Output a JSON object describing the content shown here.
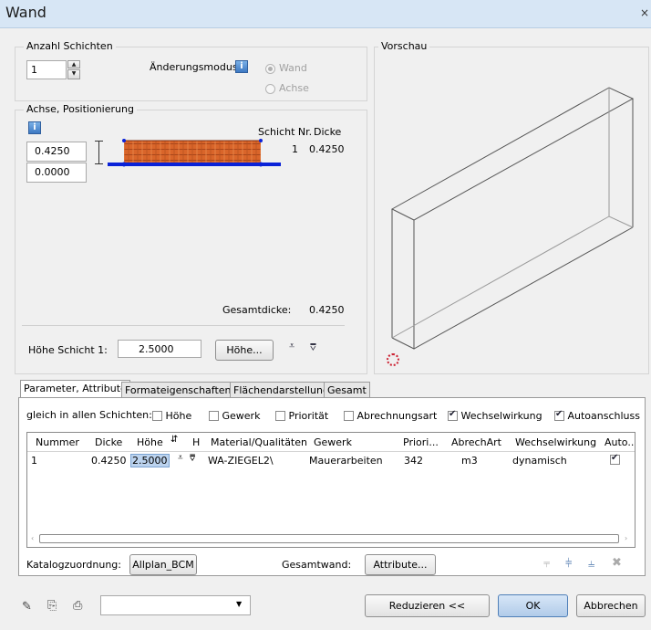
{
  "window": {
    "title": "Wand"
  },
  "layers": {
    "legend": "Anzahl Schichten",
    "count": "1",
    "mode_label": "Änderungsmodus",
    "mode_options": [
      "Wand",
      "Achse"
    ]
  },
  "axis": {
    "legend": "Achse, Positionierung",
    "value1": "0.4250",
    "value2": "0.0000",
    "col_layer_nr": "Schicht Nr.",
    "col_thickness": "Dicke",
    "row_nr": "1",
    "row_thickness": "0.4250",
    "total_label": "Gesamtdicke:",
    "total_value": "0.4250",
    "height_label": "Höhe Schicht 1:",
    "height_value": "2.5000",
    "height_button": "Höhe..."
  },
  "preview": {
    "legend": "Vorschau"
  },
  "tabs": [
    "Parameter, Attribute",
    "Formateigenschaften",
    "Flächendarstellung",
    "Gesamt"
  ],
  "all_layers": {
    "label": "gleich in allen Schichten:",
    "options": [
      {
        "label": "Höhe",
        "checked": false
      },
      {
        "label": "Gewerk",
        "checked": false
      },
      {
        "label": "Priorität",
        "checked": false
      },
      {
        "label": "Abrechnungsart",
        "checked": false
      },
      {
        "label": "Wechselwirkung",
        "checked": true
      },
      {
        "label": "Autoanschluss",
        "checked": true
      }
    ]
  },
  "table": {
    "headers": [
      "Nummer",
      "Dicke",
      "Höhe",
      "H",
      "Material/Qualitäten",
      "Gewerk",
      "Priori...",
      "AbrechArt",
      "Wechselwirkung",
      "Auto.."
    ],
    "row": {
      "nummer": "1",
      "dicke": "0.4250",
      "hoehe": "2.5000",
      "material": "WA-ZIEGEL2\\",
      "gewerk": "Mauerarbeiten",
      "prioritaet": "342",
      "abrechart": "m3",
      "wechselwirkung": "dynamisch",
      "auto": true
    }
  },
  "bottom": {
    "catalog_label": "Katalogzuordnung:",
    "catalog_button": "Allplan_BCM",
    "total_wall_label": "Gesamtwand:",
    "attribute_button": "Attribute..."
  },
  "footer": {
    "reduce_button": "Reduzieren <<",
    "ok_button": "OK",
    "cancel_button": "Abbrechen",
    "combo_value": ""
  },
  "colors": {
    "title_bg": "#d7e6f5",
    "layer_fill": "#d9652a",
    "axis_line": "#0a22d8",
    "ok_bg": "#bcd3ee"
  }
}
